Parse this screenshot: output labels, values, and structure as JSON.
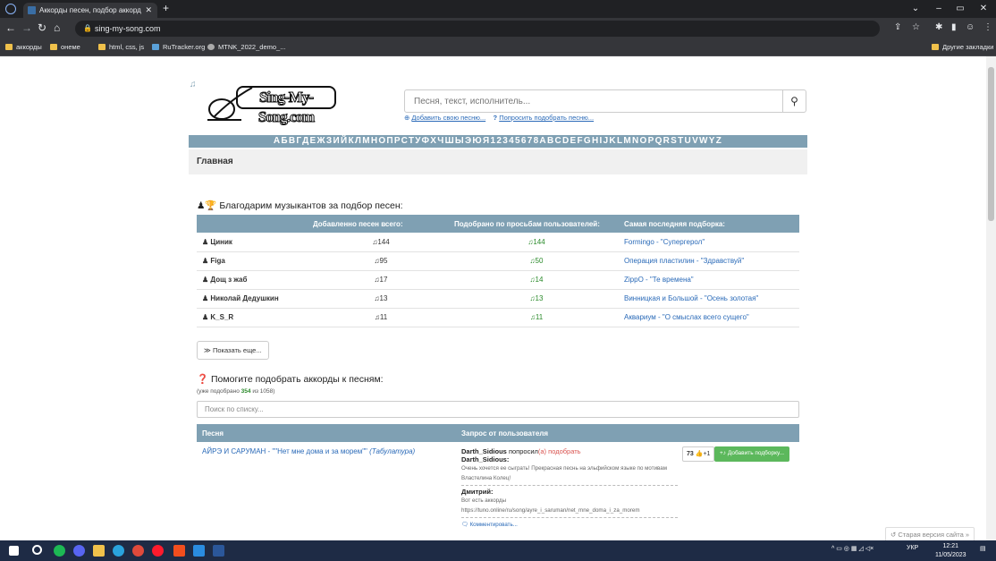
{
  "browser": {
    "tab_title": "Аккорды песен, подбор аккорд",
    "url": "sing-my-song.com",
    "bookmarks": [
      "аккорды",
      "онеме",
      "html, css, js",
      "RuTracker.org",
      "MTNK_2022_demo_..."
    ],
    "other_bookmarks": "Другие закладки"
  },
  "site": {
    "logo": "Sing-My-Song.com",
    "search_placeholder": "Песня, текст, исполнитель...",
    "add_song": "Добавить свою песню...",
    "ask_song": "Попросить подобрать песню...",
    "alphabet": "АБВГДЕЖЗИЙКЛМНОПРСТУФХЧШЫЭЮЯ12345678ABCDEFGHIJKLMNOPQRSTUVWYZ",
    "breadcrumb": "Главная"
  },
  "thanks": {
    "title": "Благодарим музыкантов за подбор песен:",
    "headers": [
      "",
      "Добавленно песен всего:",
      "Подобрано по просьбам пользователей:",
      "Самая последняя подборка:"
    ],
    "rows": [
      {
        "name": "Циник",
        "added": "144",
        "requested": "144",
        "latest": "Formingo - \"Cупергерол\""
      },
      {
        "name": "Figa",
        "added": "95",
        "requested": "50",
        "latest": "Операция пластилин - \"Здравствуй\""
      },
      {
        "name": "Дощ з жаб",
        "added": "17",
        "requested": "14",
        "latest": "ZippO - \"Те времена\""
      },
      {
        "name": "Николай Дедушкин",
        "added": "13",
        "requested": "13",
        "latest": "Винницкая и Большой - \"Осень золотая\""
      },
      {
        "name": "K_S_R",
        "added": "11",
        "requested": "11",
        "latest": "Аквариум - \"О смыслах всего сущего\""
      }
    ],
    "show_more": "Показать еще..."
  },
  "help": {
    "title": "Помогите подобрать аккорды к песням:",
    "count_prefix": "(уже подобрано",
    "count_done": "354",
    "count_suffix": "из 1058)",
    "filter_placeholder": "Поиск по списку...",
    "headers": [
      "Песня",
      "Запрос от пользователя"
    ],
    "song": "АЙРЭ И САРУМАН - \"\"Нет мне дома и за морем\"\"",
    "song_tag": "(Табулатура)",
    "requester": "Darth_Sidious",
    "requested_text": "попросил",
    "requested_suffix": "(а) подобрать",
    "comment1_author": "Darth_Sidious:",
    "comment1_text": "Очень хочется ее сыграть! Прекрасная песнь на эльфийском языке по мотивам Властелина Колец!",
    "comment2_author": "Дмитрий:",
    "comment2_line1": "Вот есть аккорды",
    "comment2_line2": "https://tuno.online/ru/song/ayre_i_saruman/net_mne_doma_i_za_morem",
    "comment_link": "Комментировать...",
    "votes": "73",
    "plus": "+1",
    "add_button": "Добавить подборку..."
  },
  "old_version": "Старая версия сайта »",
  "taskbar": {
    "lang": "УКР",
    "time": "12:21",
    "date": "11/05/2023"
  }
}
